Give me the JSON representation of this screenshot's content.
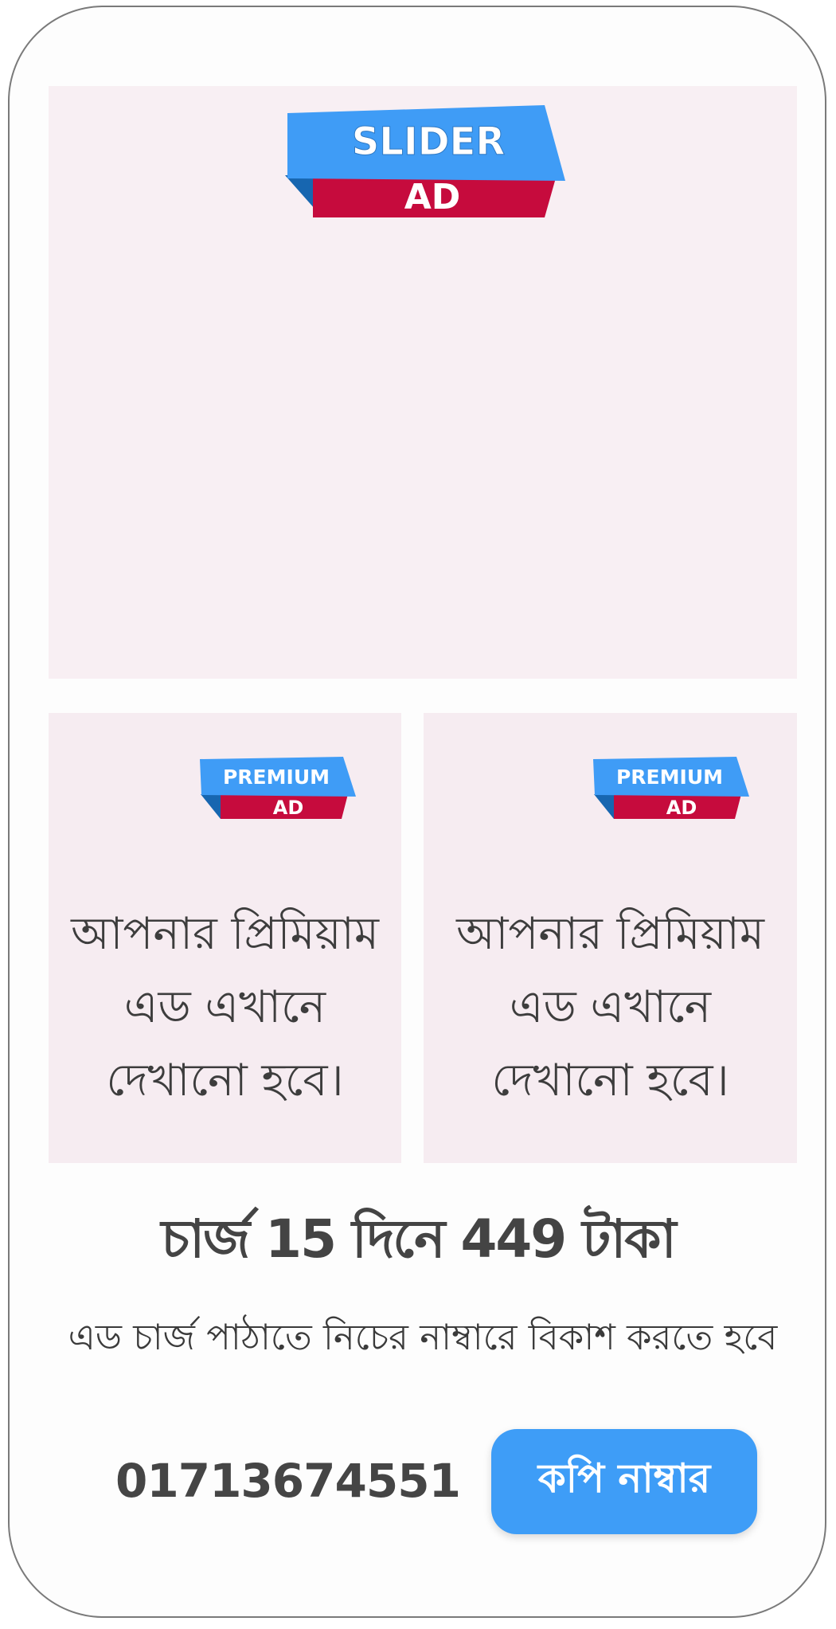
{
  "slider_ad": {
    "badge_line1": "SLIDER",
    "badge_line2": "AD"
  },
  "premium_ads": [
    {
      "badge_line1": "PREMIUM",
      "badge_line2": "AD",
      "text": "আপনার প্রিমিয়াম\nএড এখানে\nদেখানো হবে।"
    },
    {
      "badge_line1": "PREMIUM",
      "badge_line2": "AD",
      "text": "আপনার প্রিমিয়াম\nএড এখানে\nদেখানো হবে।"
    }
  ],
  "charge": {
    "title": "চার্জ 15 দিনে 449 টাকা",
    "instruction": "এড চার্জ পাঠাতে নিচের নাম্বারে বিকাশ করতে হবে"
  },
  "contact": {
    "phone_number": "01713674551",
    "copy_button_label": "কপি নাম্বার"
  },
  "colors": {
    "badge_blue": "#3f9cf6",
    "badge_red": "#c60b3d",
    "button_blue": "#3e9df7",
    "ad_background": "#f7eef2"
  }
}
